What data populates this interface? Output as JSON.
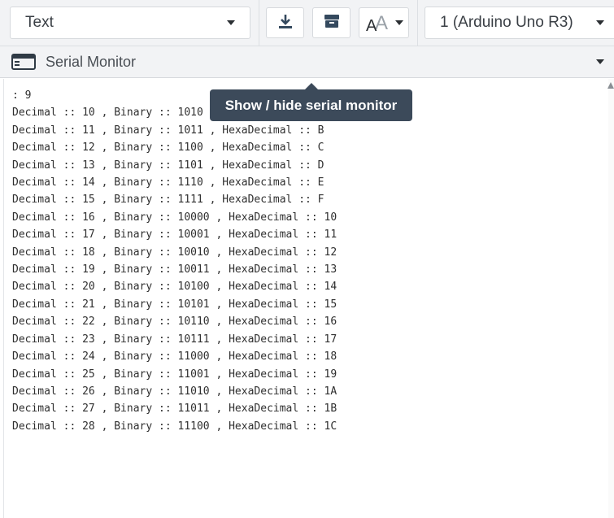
{
  "toolbar": {
    "mode_dropdown": "Text",
    "device_dropdown": "1 (Arduino Uno R3)",
    "download_icon": "download-icon",
    "clear_icon": "archive-icon",
    "font_icon": "text-size-icon"
  },
  "monitor": {
    "title": "Serial Monitor",
    "tooltip": "Show / hide serial monitor"
  },
  "output_lines": [
    ": 9",
    "Decimal :: 10 , Binary :: 1010 , HexaDecimal :: A",
    "Decimal :: 11 , Binary :: 1011 , HexaDecimal :: B",
    "Decimal :: 12 , Binary :: 1100 , HexaDecimal :: C",
    "Decimal :: 13 , Binary :: 1101 , HexaDecimal :: D",
    "Decimal :: 14 , Binary :: 1110 , HexaDecimal :: E",
    "Decimal :: 15 , Binary :: 1111 , HexaDecimal :: F",
    "Decimal :: 16 , Binary :: 10000 , HexaDecimal :: 10",
    "Decimal :: 17 , Binary :: 10001 , HexaDecimal :: 11",
    "Decimal :: 18 , Binary :: 10010 , HexaDecimal :: 12",
    "Decimal :: 19 , Binary :: 10011 , HexaDecimal :: 13",
    "Decimal :: 20 , Binary :: 10100 , HexaDecimal :: 14",
    "Decimal :: 21 , Binary :: 10101 , HexaDecimal :: 15",
    "Decimal :: 22 , Binary :: 10110 , HexaDecimal :: 16",
    "Decimal :: 23 , Binary :: 10111 , HexaDecimal :: 17",
    "Decimal :: 24 , Binary :: 11000 , HexaDecimal :: 18",
    "Decimal :: 25 , Binary :: 11001 , HexaDecimal :: 19",
    "Decimal :: 26 , Binary :: 11010 , HexaDecimal :: 1A",
    "Decimal :: 27 , Binary :: 11011 , HexaDecimal :: 1B",
    "Decimal :: 28 , Binary :: 11100 , HexaDecimal :: 1C"
  ],
  "colors": {
    "tooltip_bg": "#3c4a5a",
    "toolbar_bg": "#f2f3f5"
  }
}
